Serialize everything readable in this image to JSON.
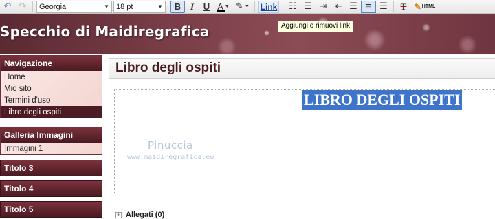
{
  "toolbar": {
    "font": "Georgia",
    "size": "18 pt",
    "bold": "B",
    "italic": "I",
    "underline": "U",
    "text_color": "A",
    "link": "Link",
    "html_label": "HTML",
    "undo_icon": "undo-icon",
    "redo_icon": "redo-icon"
  },
  "tooltip": "Aggiungi o rimuovi link",
  "header": {
    "title": "Specchio di Maidiregrafica"
  },
  "sidebar": {
    "navigation": {
      "heading": "Navigazione",
      "items": [
        {
          "label": "Home",
          "active": false
        },
        {
          "label": "Mio sito",
          "active": false
        },
        {
          "label": "Termini d'uso",
          "active": false
        },
        {
          "label": "Libro degli ospiti",
          "active": true
        }
      ]
    },
    "gallery": {
      "heading": "Galleria Immagini",
      "items": [
        {
          "label": "Immagini 1"
        }
      ]
    },
    "sections": [
      "Titolo 3",
      "Titolo 4",
      "Titolo 5"
    ]
  },
  "main": {
    "page_title": "Libro degli ospiti",
    "editor_heading": "LIBRO DEGLI OSPITI",
    "watermark_name": "Pinuccia",
    "watermark_url": "www.maidiregrafica.eu",
    "attachments": "Allegati (0)"
  },
  "colors": {
    "accent": "#4a1a22",
    "selection": "#3e74c9",
    "banner": "#7a3e48"
  }
}
